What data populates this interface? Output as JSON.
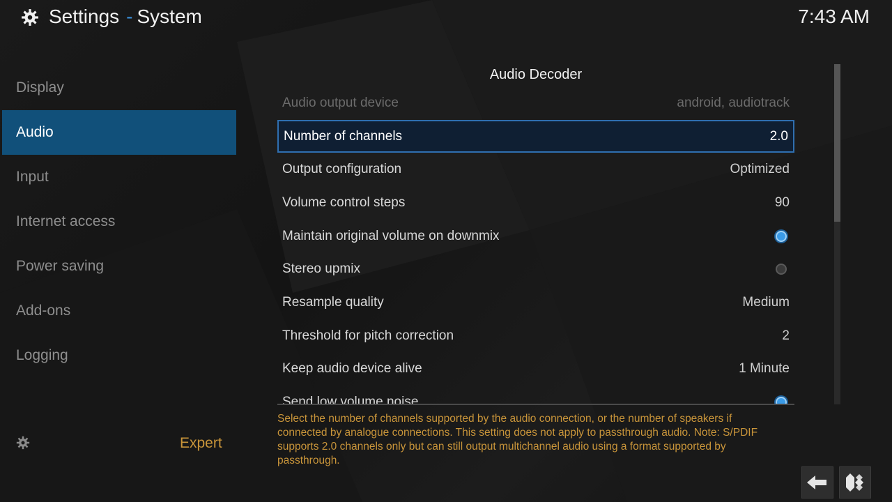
{
  "header": {
    "title": "Settings",
    "separator": "-",
    "subtitle": "System",
    "clock": "7:43 AM",
    "icon": "gear-icon"
  },
  "sidebar": {
    "items": [
      {
        "label": "Display",
        "active": false
      },
      {
        "label": "Audio",
        "active": true
      },
      {
        "label": "Input",
        "active": false
      },
      {
        "label": "Internet access",
        "active": false
      },
      {
        "label": "Power saving",
        "active": false
      },
      {
        "label": "Add-ons",
        "active": false
      },
      {
        "label": "Logging",
        "active": false
      }
    ],
    "level_label": "Expert",
    "level_icon": "gear-icon"
  },
  "main": {
    "section_title": "Audio Decoder",
    "rows": [
      {
        "label": "Audio output device",
        "value": "android, audiotrack",
        "state": "disabled"
      },
      {
        "label": "Number of channels",
        "value": "2.0",
        "state": "focused"
      },
      {
        "label": "Output configuration",
        "value": "Optimized"
      },
      {
        "label": "Volume control steps",
        "value": "90"
      },
      {
        "label": "Maintain original volume on downmix",
        "toggle": "on"
      },
      {
        "label": "Stereo upmix",
        "toggle": "off"
      },
      {
        "label": "Resample quality",
        "value": "Medium"
      },
      {
        "label": "Threshold for pitch correction",
        "value": "2"
      },
      {
        "label": "Keep audio device alive",
        "value": "1 Minute"
      },
      {
        "label": "Send low volume noise",
        "toggle": "on"
      }
    ],
    "help_text": "Select the number of channels supported by the audio connection, or the number of speakers if connected by analogue connections. This setting does not apply to passthrough audio. Note: S/PDIF supports 2.0 channels only but can still output multichannel audio using a format supported by passthrough."
  },
  "footer": {
    "back_icon": "back-arrow-icon",
    "home_icon": "kodi-logo-icon"
  },
  "colors": {
    "accent": "#11507a",
    "focus_border": "#2f6fb0",
    "help_text": "#c9953a",
    "title_separator": "#3a8fd8"
  }
}
